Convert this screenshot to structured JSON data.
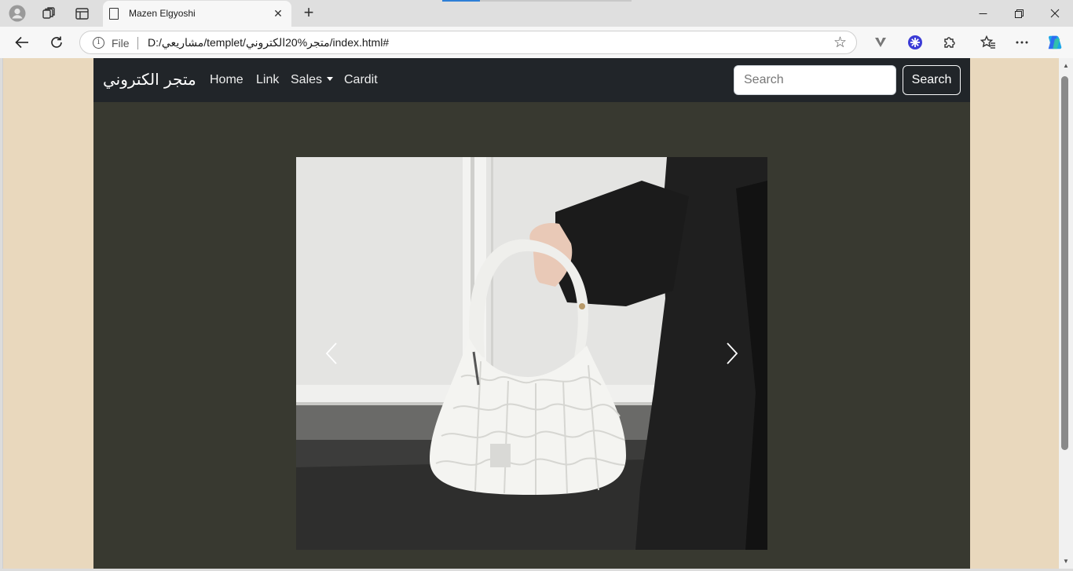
{
  "browser": {
    "tab_title": "Mazen Elgyoshi",
    "new_tab_symbol": "+",
    "url_scheme_label": "File",
    "url": "D:/مشاريعي/templet/متجر%20الكتروني/index.html#",
    "window_controls": [
      "minimize",
      "restore",
      "close"
    ]
  },
  "navbar": {
    "brand": "متجر الكتروني",
    "links": [
      {
        "label": "Home"
      },
      {
        "label": "Link"
      },
      {
        "label": "Sales",
        "dropdown": true
      },
      {
        "label": "Cardit"
      }
    ],
    "search_placeholder": "Search",
    "search_button": "Search"
  },
  "carousel": {
    "current_slide_subject": "white quilted hobo handbag",
    "controls": [
      "previous",
      "next"
    ]
  },
  "colors": {
    "page_background": "#e9d8bd",
    "navbar_background": "#212529",
    "content_background": "#383930",
    "edge_loading_accent": "#0078d4"
  }
}
